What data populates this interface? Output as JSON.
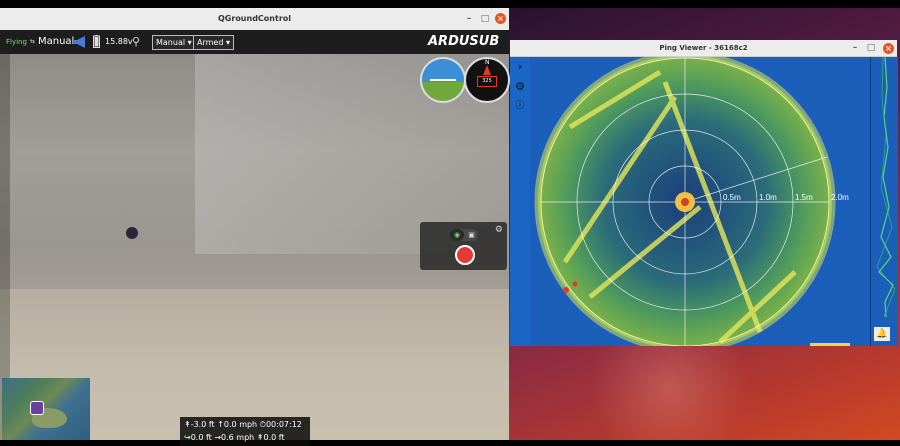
{
  "qgc": {
    "title": "QGroundControl",
    "status": "Flying",
    "mode": "Manual",
    "battery": "15.88v",
    "mode_dropdown": "Manual",
    "arm_dropdown": "Armed",
    "logo": "ARDUSUB",
    "telemetry": {
      "alt": "-3.0 ft",
      "vspeed": "0.0 mph",
      "time": "00:07:12",
      "dist": "0.0 ft",
      "hspeed": "0.6 mph",
      "home": "0.0 ft"
    },
    "compass_heading": "325",
    "compass_n": "N"
  },
  "ping": {
    "title": "Ping Viewer - 36168c2",
    "range_labels": [
      "0.5m",
      "1.0m",
      "1.5m",
      "2.0m"
    ]
  },
  "colors": {
    "accent": "#e95420",
    "flying": "#6ee36b",
    "sonar_bg": "#1b5fbb"
  },
  "icons": {
    "horn": "megaphone-icon",
    "battery": "battery-icon",
    "signal": "remote-signal-icon",
    "gear": "gear-icon",
    "record": "record-icon"
  }
}
